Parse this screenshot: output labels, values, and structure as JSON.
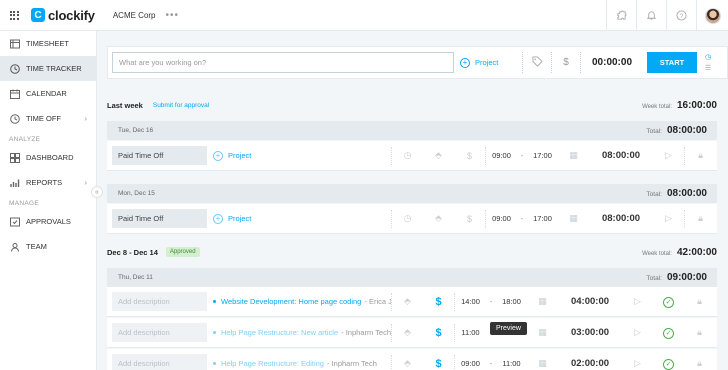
{
  "app": {
    "name": "clockify",
    "workspace": "ACME Corp",
    "workspace_more": "•••",
    "accent": "#03a9f4"
  },
  "top_icons": [
    "puzzle-icon",
    "bell-icon",
    "help-icon"
  ],
  "sidebar": {
    "items": [
      {
        "label": "TIMESHEET",
        "icon": "timesheet-icon"
      },
      {
        "label": "TIME TRACKER",
        "icon": "clock-icon",
        "active": true
      },
      {
        "label": "CALENDAR",
        "icon": "calendar-icon"
      },
      {
        "label": "TIME OFF",
        "icon": "time-off-icon"
      }
    ],
    "analyze_label": "ANALYZE",
    "analyze_items": [
      {
        "label": "DASHBOARD",
        "icon": "dashboard-icon"
      },
      {
        "label": "REPORTS",
        "icon": "reports-icon"
      }
    ],
    "manage_label": "MANAGE",
    "manage_items": [
      {
        "label": "APPROVALS",
        "icon": "approvals-icon"
      },
      {
        "label": "TEAM",
        "icon": "team-icon"
      }
    ]
  },
  "timer": {
    "placeholder": "What are you working on?",
    "project_label": "Project",
    "time": "00:00:00",
    "start_label": "START"
  },
  "weeks": [
    {
      "title": "Last week",
      "link": "Submit for approval",
      "total_label": "Week total:",
      "total": "16:00:00",
      "days": [
        {
          "date": "Tue, Dec 16",
          "total_label": "Total:",
          "total": "08:00:00",
          "entries": [
            {
              "desc": "Paid Time Off",
              "project": "Project",
              "start": "09:00",
              "end": "17:00",
              "duration": "08:00:00"
            }
          ]
        },
        {
          "date": "Mon, Dec 15",
          "total_label": "Total:",
          "total": "08:00:00",
          "entries": [
            {
              "desc": "Paid Time Off",
              "project": "Project",
              "start": "09:00",
              "end": "17:00",
              "duration": "08:00:00"
            }
          ]
        }
      ]
    },
    {
      "title": "Dec 8 - Dec 14",
      "badge": "Approved",
      "total_label": "Week total:",
      "total": "42:00:00",
      "days": [
        {
          "date": "Thu, Dec 11",
          "total_label": "Total:",
          "total": "09:00:00",
          "entries": [
            {
              "desc": "Add description",
              "project": "Website Development: Home page coding",
              "client": "- Erica J...",
              "start": "14:00",
              "end": "18:00",
              "duration": "04:00:00"
            },
            {
              "desc": "Add description",
              "project": "Help Page Restructure: New article",
              "client": "- Inpharm Tech",
              "start": "11:00",
              "end": "14:00",
              "duration": "03:00:00"
            },
            {
              "desc": "Add description",
              "project": "Help Page Restructure: Editing",
              "client": "- Inpharm Tech",
              "start": "09:00",
              "end": "11:00",
              "duration": "02:00:00"
            }
          ]
        }
      ]
    }
  ],
  "tooltip": "Preview"
}
